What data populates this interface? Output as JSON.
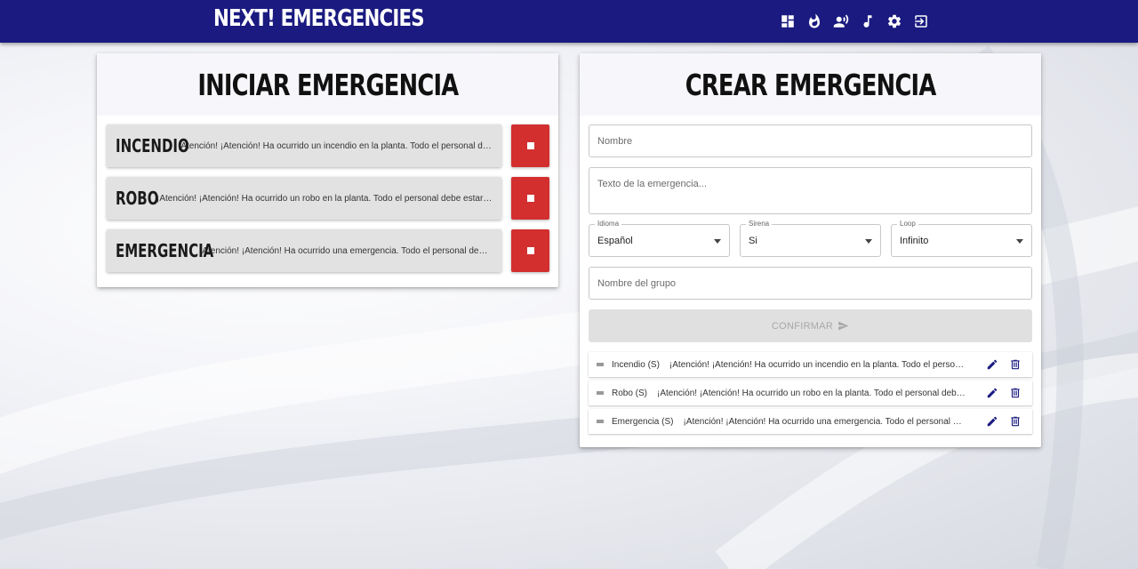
{
  "app": {
    "brand": "NEXT! EMERGENCIES"
  },
  "nav_icons": [
    "dashboard-icon",
    "fire-icon",
    "record-voice-icon",
    "music-note-icon",
    "settings-icon",
    "logout-icon"
  ],
  "colors": {
    "appbar": "#1a1a80",
    "stop": "#d32f2f",
    "action_icon": "#1a1a80"
  },
  "start_panel": {
    "title": "INICIAR EMERGENCIA",
    "emergencies": [
      {
        "name": "INCENDIO",
        "text": "¡Atención! ¡Atención! Ha ocurrido un incendio en la planta. Todo el personal debe estar atento y seguir las instrucciones"
      },
      {
        "name": "ROBO",
        "text": "¡Atención! ¡Atención! Ha ocurrido un robo en la planta. Todo el personal debe estar atento y seguir las instrucciones"
      },
      {
        "name": "EMERGENCIA",
        "text": "¡Atención! ¡Atención! Ha ocurrido una emergencia. Todo el personal debe estar atento y seguir las instrucciones"
      }
    ]
  },
  "create_panel": {
    "title": "CREAR EMERGENCIA",
    "name_placeholder": "Nombre",
    "text_placeholder": "Texto de la emergencia...",
    "idioma": {
      "label": "Idioma",
      "value": "Español"
    },
    "sirena": {
      "label": "Sirena",
      "value": "Si"
    },
    "loop": {
      "label": "Loop",
      "value": "Infinito"
    },
    "group_placeholder": "Nombre del grupo",
    "confirm_label": "CONFIRMAR",
    "items": [
      {
        "name": "Incendio (S)",
        "text": "¡Atención! ¡Atención! Ha ocurrido un incendio en la planta. Todo el personal debe estar atento y seguir las instrucciones"
      },
      {
        "name": "Robo (S)",
        "text": "¡Atención! ¡Atención! Ha ocurrido un robo en la planta. Todo el personal debe estar atento y seguir las instrucciones"
      },
      {
        "name": "Emergencia (S)",
        "text": "¡Atención! ¡Atención! Ha ocurrido una emergencia. Todo el personal debe estar atento y seguir las instrucciones"
      }
    ]
  }
}
